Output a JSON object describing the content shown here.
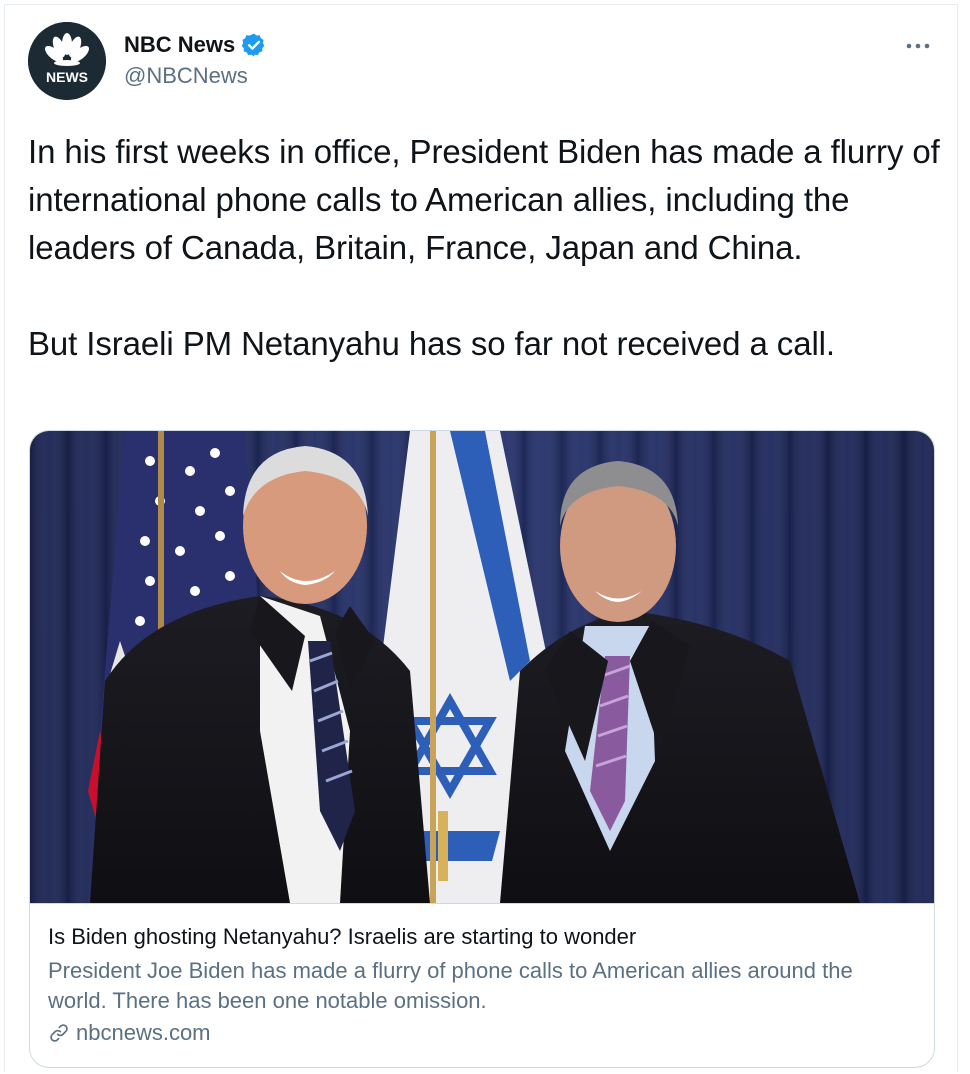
{
  "tweet": {
    "author": {
      "name": "NBC News",
      "handle": "@NBCNews",
      "avatar_text": "NEWS",
      "verified": true
    },
    "text": "In his first weeks in office, President Biden has made a flurry of international phone calls to American allies, including the leaders of Canada, Britain, France, Japan and China.\n\nBut Israeli PM Netanyahu has so far not received a call."
  },
  "card": {
    "title": "Is Biden ghosting Netanyahu? Israelis are starting to wonder",
    "description": "President Joe Biden has made a flurry of phone calls to American allies around the world. There has been one notable omission.",
    "domain": "nbcnews.com"
  },
  "colors": {
    "verified": "#1d9bf0",
    "secondary_text": "#5b7083",
    "avatar_bg": "#1c2a33"
  }
}
